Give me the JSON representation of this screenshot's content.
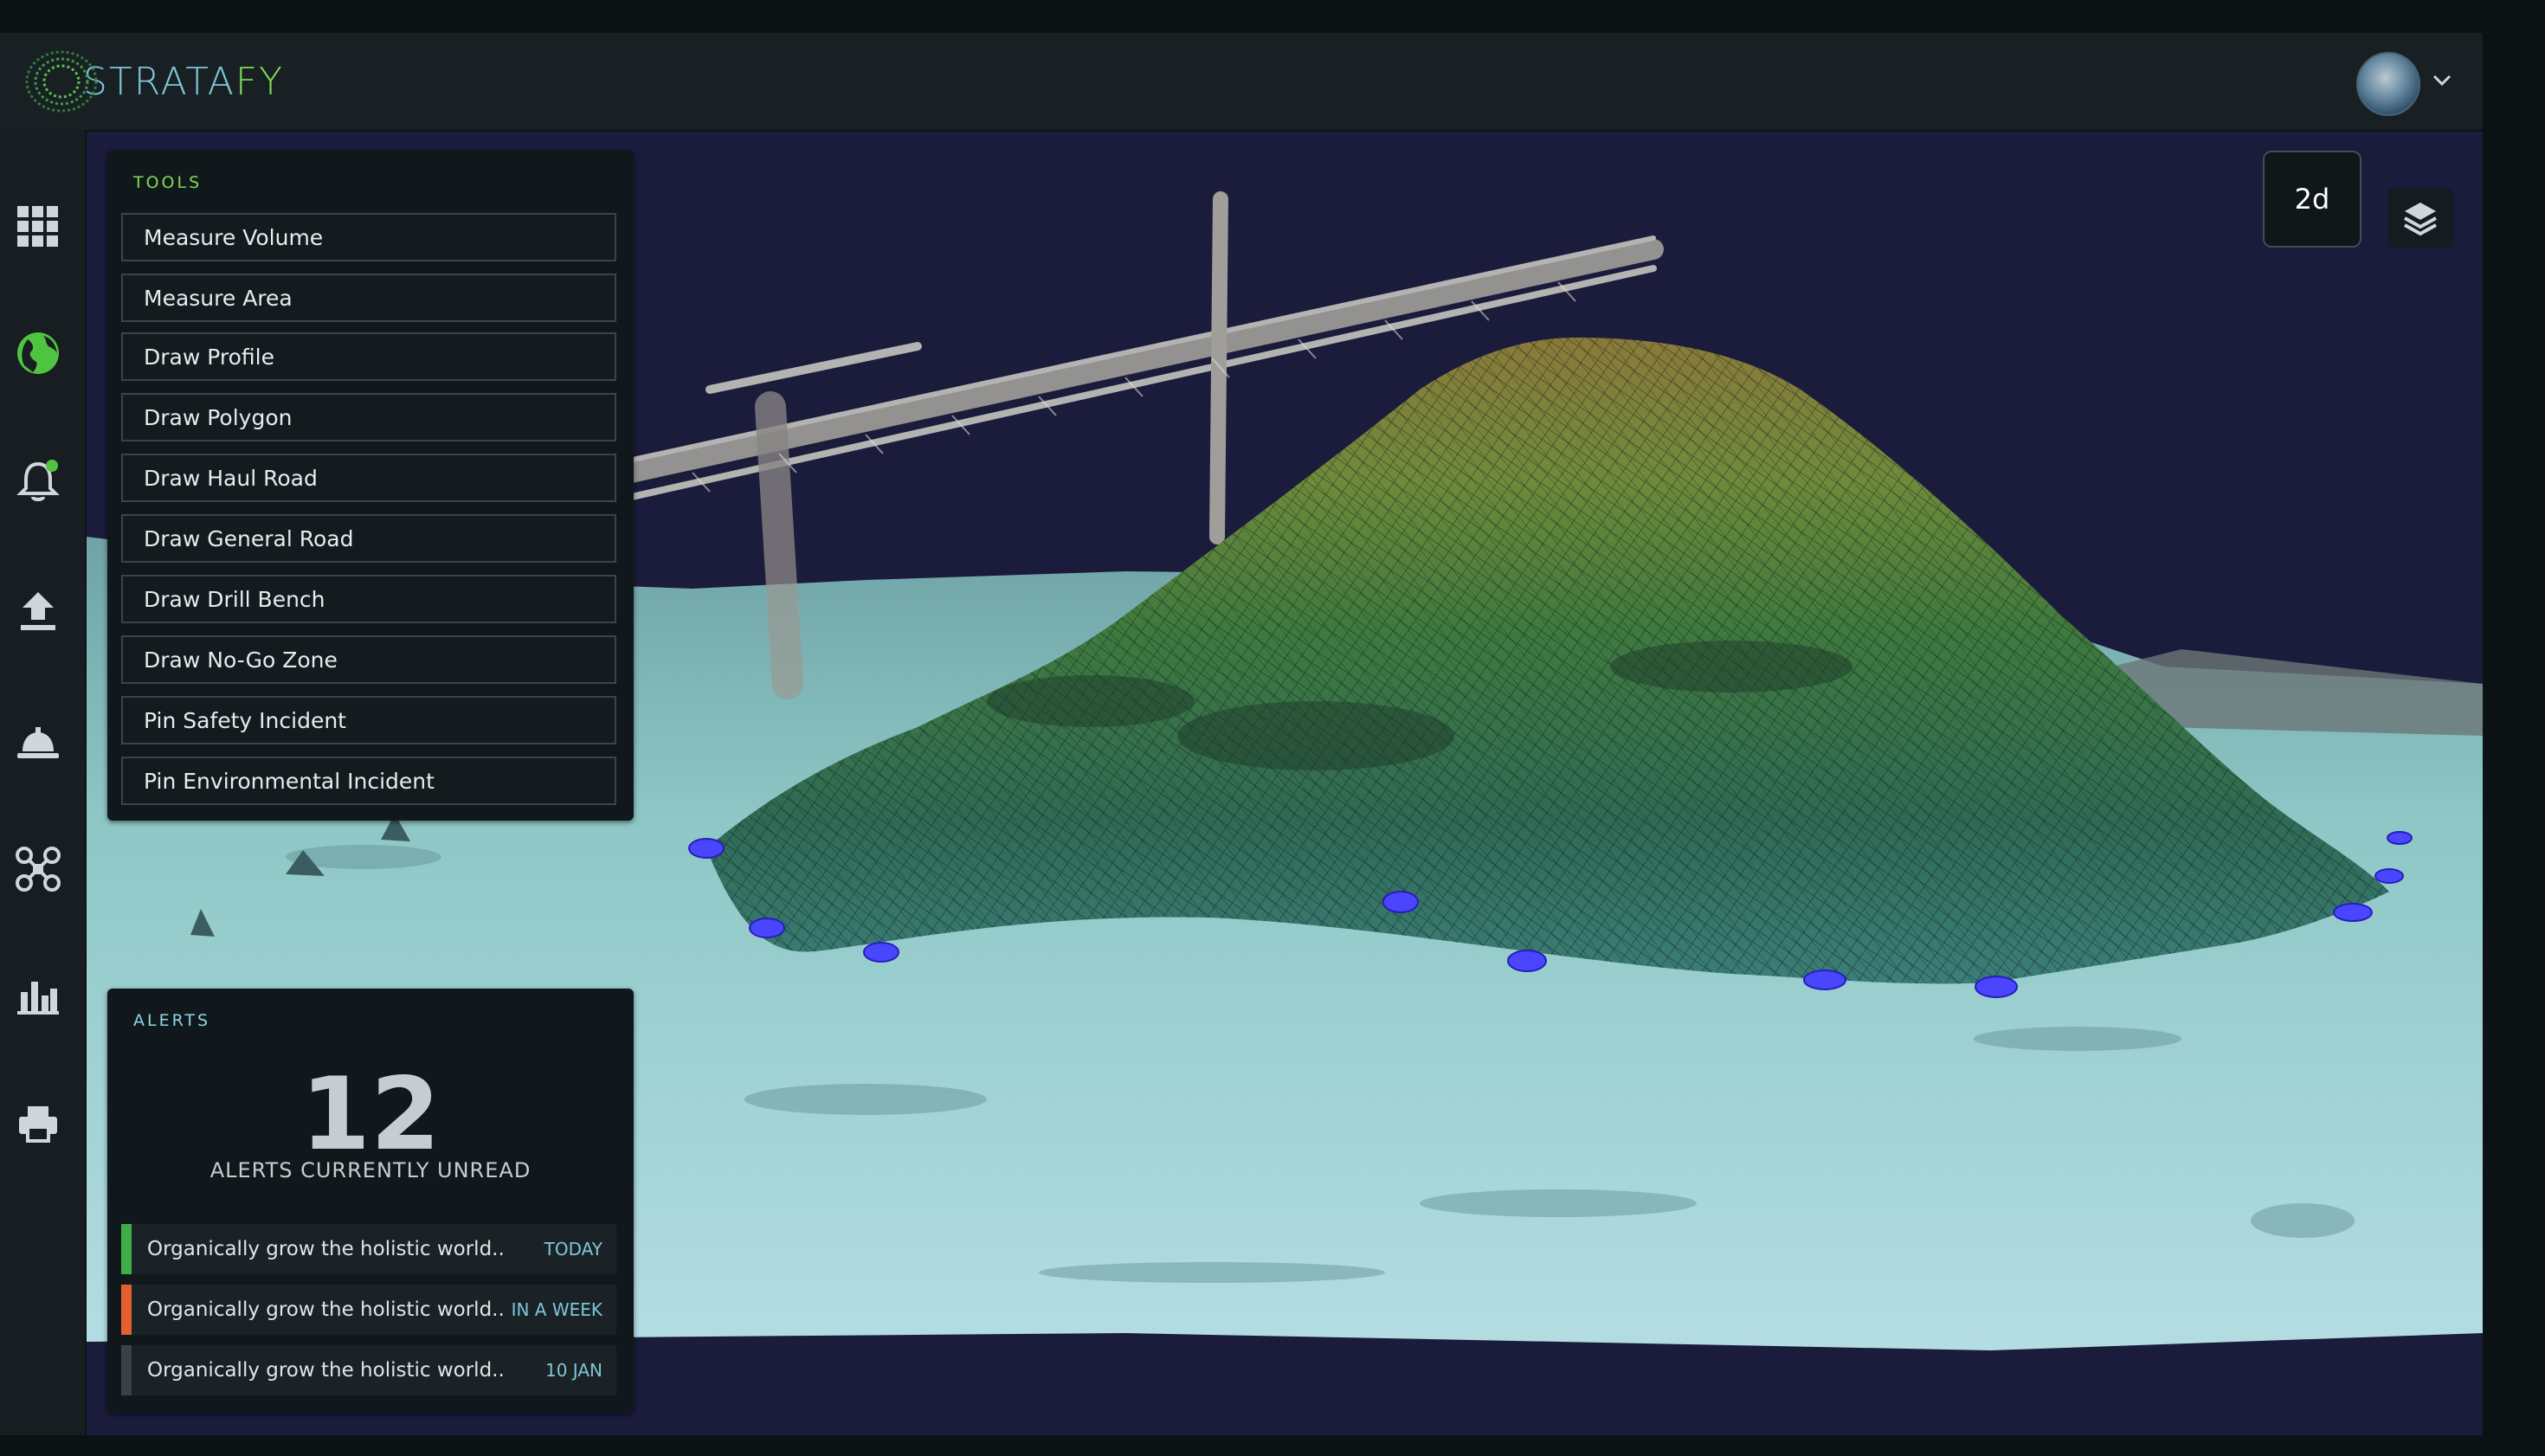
{
  "brand": {
    "name_part1": "STRATA",
    "name_part2": "FY"
  },
  "user": {
    "avatar_icon": "user-avatar-icon"
  },
  "sidebar": {
    "items": [
      {
        "icon": "grid-icon",
        "active": false
      },
      {
        "icon": "globe-icon",
        "active": true
      },
      {
        "icon": "bell-icon",
        "active": false,
        "badge": true
      },
      {
        "icon": "upload-icon",
        "active": false
      },
      {
        "icon": "hard-hat-icon",
        "active": false
      },
      {
        "icon": "drone-icon",
        "active": false
      },
      {
        "icon": "bar-chart-icon",
        "active": false
      },
      {
        "icon": "printer-icon",
        "active": false
      }
    ]
  },
  "tools": {
    "title": "TOOLS",
    "items": [
      "Measure Volume",
      "Measure Area",
      "Draw Profile",
      "Draw Polygon",
      "Draw Haul Road",
      "Draw General Road",
      "Draw Drill Bench",
      "Draw No-Go Zone",
      "Pin Safety Incident",
      "Pin Environmental Incident"
    ]
  },
  "alerts": {
    "title": "ALERTS",
    "count": "12",
    "subtitle": "ALERTS CURRENTLY UNREAD",
    "items": [
      {
        "text": "Organically grow the holistic world..",
        "when": "TODAY",
        "color": "#3fae49"
      },
      {
        "text": "Organically grow the holistic world..",
        "when": "IN A WEEK",
        "color": "#e4612f"
      },
      {
        "text": "Organically grow the holistic world..",
        "when": "10 JAN",
        "color": "#3b4246"
      }
    ]
  },
  "view": {
    "mode_label": "2d",
    "layers_icon": "layers-icon"
  },
  "colors": {
    "accent_green": "#7fd957",
    "accent_cyan": "#7fc6d8",
    "marker_blue": "#4a45ff"
  }
}
